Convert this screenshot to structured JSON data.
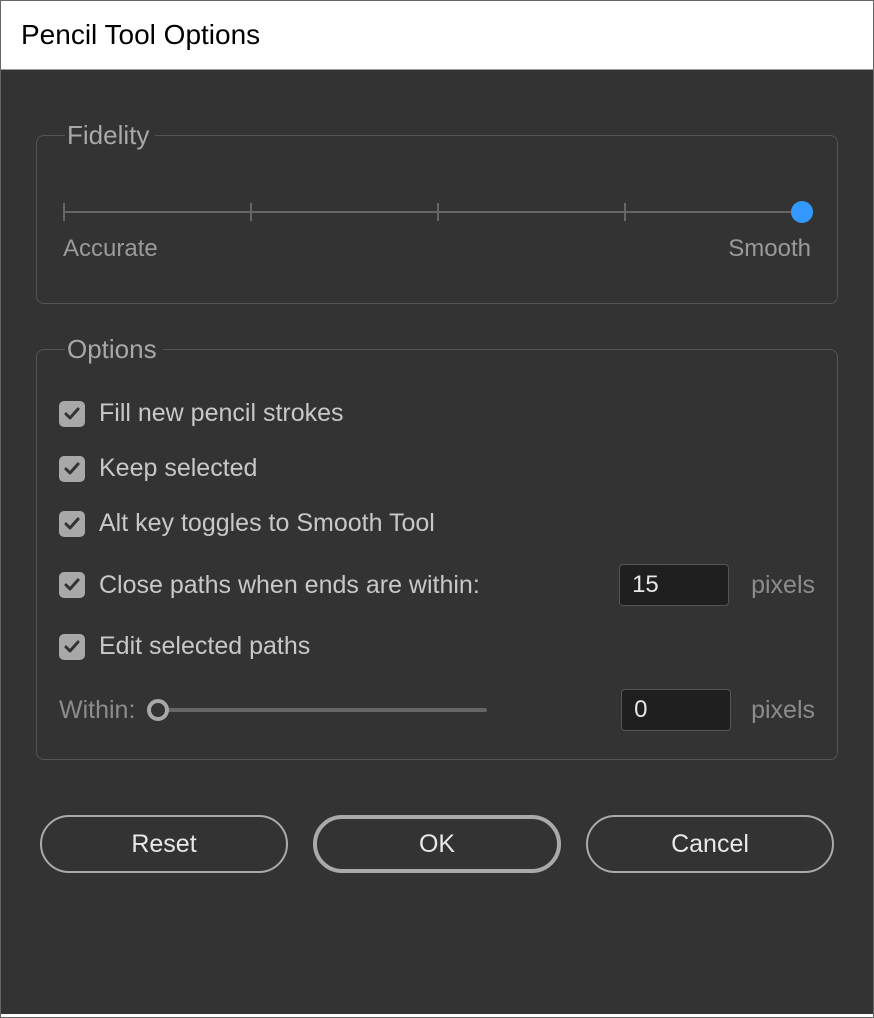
{
  "title": "Pencil Tool Options",
  "fidelity": {
    "legend": "Fidelity",
    "left_label": "Accurate",
    "right_label": "Smooth"
  },
  "options": {
    "legend": "Options",
    "fill_label": "Fill new pencil strokes",
    "keep_label": "Keep selected",
    "alt_label": "Alt key toggles to Smooth Tool",
    "close_label": "Close paths when ends are within:",
    "close_value": "15",
    "close_unit": "pixels",
    "edit_label": "Edit selected paths",
    "within_label": "Within:",
    "within_value": "0",
    "within_unit": "pixels"
  },
  "buttons": {
    "reset": "Reset",
    "ok": "OK",
    "cancel": "Cancel"
  }
}
